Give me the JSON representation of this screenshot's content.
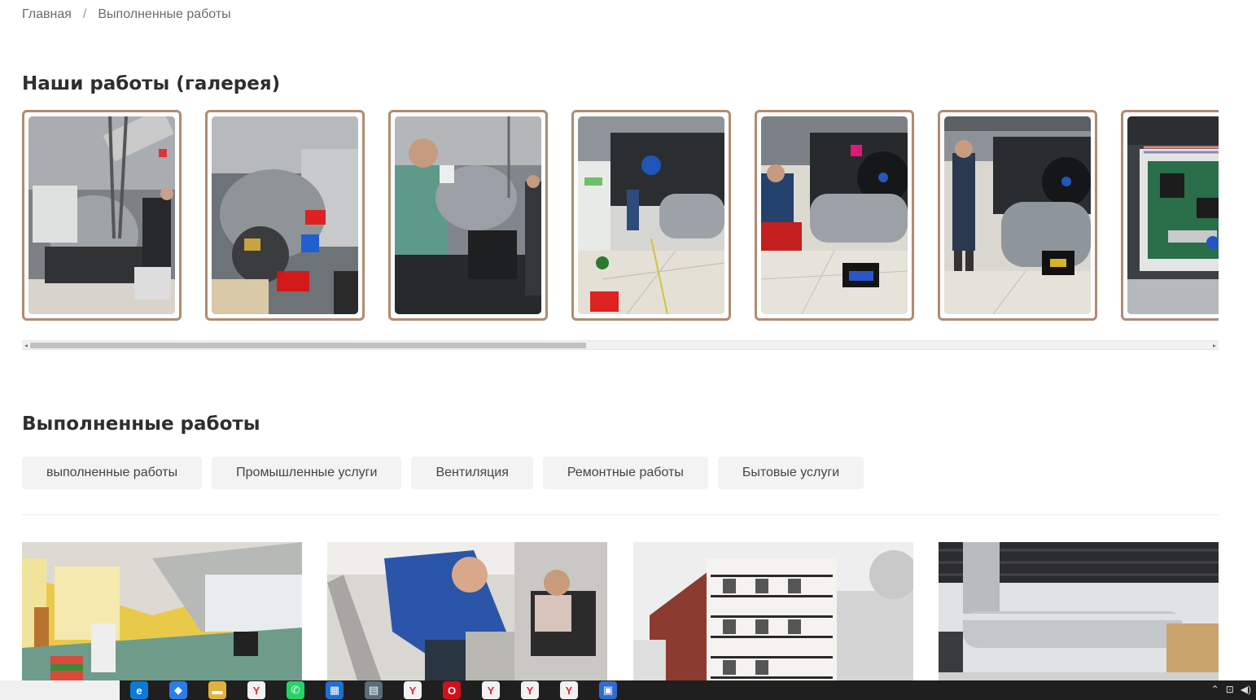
{
  "breadcrumb": {
    "home": "Главная",
    "separator": "/",
    "current": "Выполненные работы"
  },
  "gallery": {
    "title": "Наши работы (галерея)",
    "border_color": "#b08b73",
    "scroll_position": 0.47
  },
  "works": {
    "title": "Выполненные работы",
    "tabs": [
      "выполненные работы",
      "Промышленные услуги",
      "Вентиляция",
      "Ремонтные работы",
      "Бытовые услуги"
    ]
  },
  "taskbar": {
    "icons": [
      "edge-icon",
      "vscode-icon",
      "folder-icon",
      "yandex-browser-icon",
      "whatsapp-icon",
      "store-icon",
      "calculator-icon",
      "yandex-browser-icon",
      "opera-icon",
      "yandex-browser-icon",
      "yandex-browser-icon",
      "yandex-browser-icon",
      "photos-icon"
    ],
    "tray_icons": [
      "chevron-up-icon",
      "network-icon",
      "volume-icon"
    ]
  }
}
